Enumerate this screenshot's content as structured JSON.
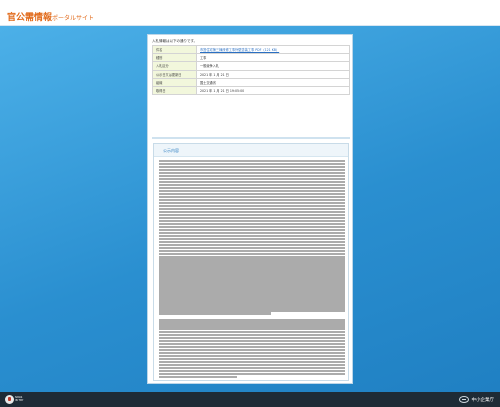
{
  "header": {
    "title_main": "官公需情報",
    "title_sub": "ポータルサイト"
  },
  "panel": {
    "intro": "入札情報は以下の通りです。",
    "rows": [
      {
        "label": "件名",
        "value": "市営住宅第三棟改修工事外壁塗装工事 PDF（121 KB）",
        "link": true
      },
      {
        "label": "種別",
        "value": "工事",
        "link": false
      },
      {
        "label": "入札区分",
        "value": "一般競争入札",
        "link": false
      },
      {
        "label": "公示日又は更新日",
        "value": "2021 年 1 月 21 日",
        "link": false
      },
      {
        "label": "組織",
        "value": "国土交通省",
        "link": false
      },
      {
        "label": "取得日",
        "value": "2021 年 1 月 21 日 19:05:00",
        "link": false
      }
    ],
    "notice_heading": "公示内容"
  },
  "footer": {
    "badge_line1": "SDGS",
    "badge_line2": "IN TRY",
    "org_name": "中小企業庁"
  }
}
